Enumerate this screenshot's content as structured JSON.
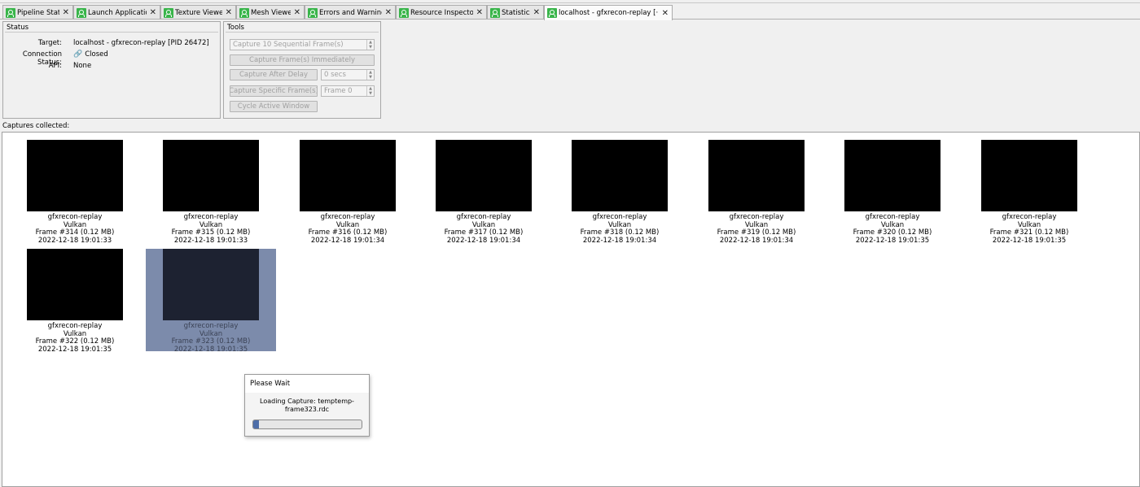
{
  "tabs": [
    {
      "label": "Pipeline State",
      "active": false
    },
    {
      "label": "Launch Application",
      "active": false
    },
    {
      "label": "Texture Viewer",
      "active": false
    },
    {
      "label": "Mesh Viewer",
      "active": false
    },
    {
      "label": "Errors and Warnings",
      "active": false
    },
    {
      "label": "Resource Inspector",
      "active": false
    },
    {
      "label": "Statistics",
      "active": false
    },
    {
      "label": "localhost - gfxrecon-replay [···",
      "active": true
    }
  ],
  "tab_close_glyph": "✕",
  "status": {
    "title": "Status",
    "target_key": "Target:",
    "target_value": "localhost - gfxrecon-replay [PID 26472]",
    "connection_key": "Connection Status:",
    "connection_value": "Closed",
    "api_key": "API:",
    "api_value": "None"
  },
  "tools": {
    "title": "Tools",
    "capture_sequential": "Capture 10 Sequential Frame(s)",
    "capture_immediately": "Capture Frame(s) Immediately",
    "capture_after_delay": "Capture After Delay",
    "delay_value": "0 secs",
    "capture_specific": "Capture Specific Frame(s)",
    "frame_value": "Frame 0",
    "cycle_window": "Cycle Active Window"
  },
  "captures_label": "Captures collected:",
  "captures": [
    {
      "app": "gfxrecon-replay",
      "api": "Vulkan",
      "frame": "Frame #314 (0.12 MB)",
      "time": "2022-12-18 19:01:33",
      "selected": false
    },
    {
      "app": "gfxrecon-replay",
      "api": "Vulkan",
      "frame": "Frame #315 (0.12 MB)",
      "time": "2022-12-18 19:01:33",
      "selected": false
    },
    {
      "app": "gfxrecon-replay",
      "api": "Vulkan",
      "frame": "Frame #316 (0.12 MB)",
      "time": "2022-12-18 19:01:34",
      "selected": false
    },
    {
      "app": "gfxrecon-replay",
      "api": "Vulkan",
      "frame": "Frame #317 (0.12 MB)",
      "time": "2022-12-18 19:01:34",
      "selected": false
    },
    {
      "app": "gfxrecon-replay",
      "api": "Vulkan",
      "frame": "Frame #318 (0.12 MB)",
      "time": "2022-12-18 19:01:34",
      "selected": false
    },
    {
      "app": "gfxrecon-replay",
      "api": "Vulkan",
      "frame": "Frame #319 (0.12 MB)",
      "time": "2022-12-18 19:01:34",
      "selected": false
    },
    {
      "app": "gfxrecon-replay",
      "api": "Vulkan",
      "frame": "Frame #320 (0.12 MB)",
      "time": "2022-12-18 19:01:35",
      "selected": false
    },
    {
      "app": "gfxrecon-replay",
      "api": "Vulkan",
      "frame": "Frame #321 (0.12 MB)",
      "time": "2022-12-18 19:01:35",
      "selected": false
    },
    {
      "app": "gfxrecon-replay",
      "api": "Vulkan",
      "frame": "Frame #322 (0.12 MB)",
      "time": "2022-12-18 19:01:35",
      "selected": false
    },
    {
      "app": "gfxrecon-replay",
      "api": "Vulkan",
      "frame": "Frame #323 (0.12 MB)",
      "time": "2022-12-18 19:01:35",
      "selected": true
    }
  ],
  "dialog": {
    "title": "Please Wait",
    "message": "Loading Capture: temptemp-frame323.rdc",
    "progress": 0.05
  },
  "colors": {
    "tab_icon": "#39b54a",
    "selected_item": "#7c8bab",
    "progress_fill": "#4e6ea8"
  }
}
